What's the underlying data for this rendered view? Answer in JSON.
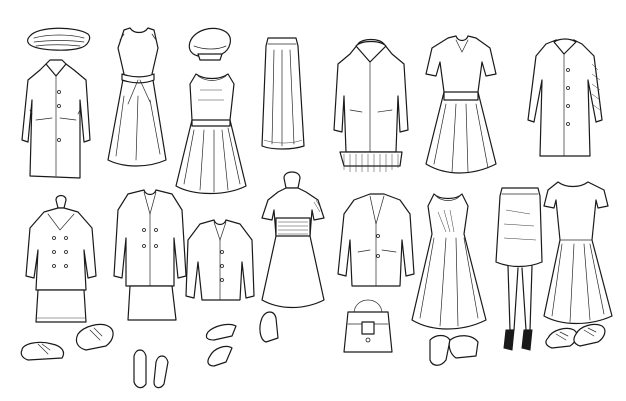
{
  "illustration": {
    "style": "black ink line sketch on white",
    "background": "#ffffff",
    "ink_color": "#1a1a1a",
    "items": [
      "scarf",
      "coat-with-collar",
      "sleeveless-belted-dress",
      "beret-hat",
      "sleeveless-flared-dress",
      "long-pencil-skirt",
      "hooded-parka",
      "short-sleeve-belted-dress",
      "long-button-coat",
      "double-breasted-suit-on-mannequin",
      "oxford-shoes",
      "two-piece-skirt-suit",
      "pumps",
      "fitted-jacket",
      "high-heel-shoes",
      "dress-on-mannequin",
      "blazer",
      "handbag",
      "sleeveless-a-line-dress",
      "lace-up-heels",
      "pencil-skirt-on-legs",
      "short-sleeve-dress",
      "sneakers"
    ]
  }
}
